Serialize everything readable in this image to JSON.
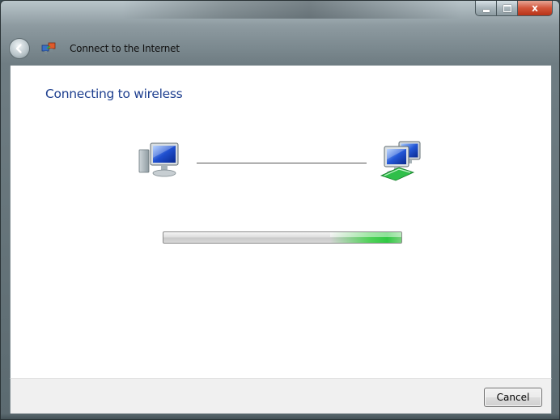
{
  "window": {
    "title": "Connect to the Internet",
    "close_glyph": "x"
  },
  "content": {
    "heading": "Connecting to wireless",
    "progress_fraction": 0.3
  },
  "footer": {
    "cancel_label": "Cancel"
  },
  "colors": {
    "heading": "#1e3f8f",
    "progress_green": "#3cd246"
  },
  "icons": [
    "back-arrow-icon",
    "network-connection-icon",
    "computer-icon",
    "network-computers-icon"
  ]
}
